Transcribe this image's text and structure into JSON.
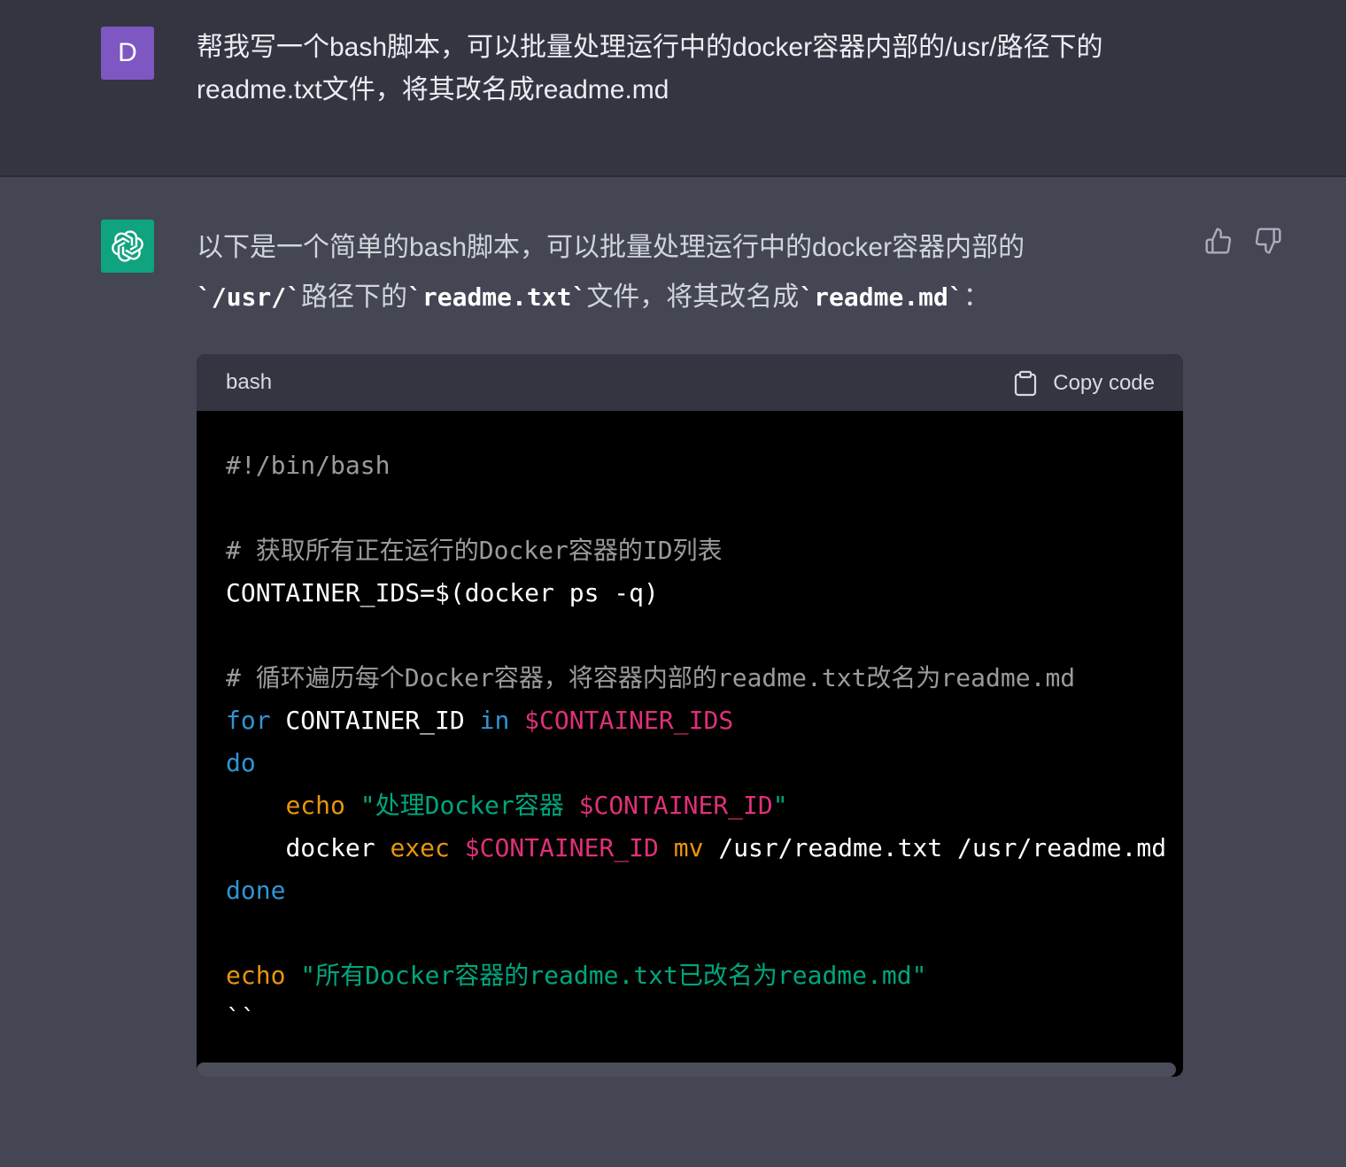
{
  "user": {
    "avatar_letter": "D",
    "message_line1": "帮我写一个bash脚本，可以批量处理运行中的docker容器内部的/usr/路径下的",
    "message_line2": "readme.txt文件，将其改名成readme.md"
  },
  "assistant": {
    "text_line1": "以下是一个简单的bash脚本，可以批量处理运行中的docker容器内部的",
    "text_line2_parts": [
      "`/usr/`",
      "路径下的",
      "`readme.txt`",
      "文件，将其改名成",
      "`readme.md`",
      "："
    ],
    "feedback": {
      "thumbs_up_icon": "thumbs-up-icon",
      "thumbs_down_icon": "thumbs-down-icon"
    }
  },
  "code_block": {
    "language": "bash",
    "copy_label": "Copy code",
    "lines": {
      "l1": "#!/bin/bash",
      "l3": "# 获取所有正在运行的Docker容器的ID列表",
      "l4": "CONTAINER_IDS=$(docker ps -q)",
      "l6": "# 循环遍历每个Docker容器，将容器内部的readme.txt改名为readme.md",
      "l7_for": "for",
      "l7_id": " CONTAINER_ID ",
      "l7_in": "in",
      "l7_var": "$CONTAINER_IDS",
      "l8": "do",
      "l9_echo": "echo",
      "l9_str1": "\"处理Docker容器 ",
      "l9_var": "$CONTAINER_ID",
      "l9_str2": "\"",
      "l10_docker": "docker ",
      "l10_exec": "exec",
      "l10_var": "$CONTAINER_ID",
      "l10_mv": "mv",
      "l10_rest": " /usr/readme.txt /usr/readme.md",
      "l11": "done",
      "l13_echo": "echo",
      "l13_str": "\"所有Docker容器的readme.txt已改名为readme.md\"",
      "l14": "``"
    }
  },
  "colors": {
    "keyword": "#2e95d3",
    "variable": "#df3079",
    "command": "#e9950c",
    "string": "#00a67d",
    "comment": "#9b9b9b"
  }
}
